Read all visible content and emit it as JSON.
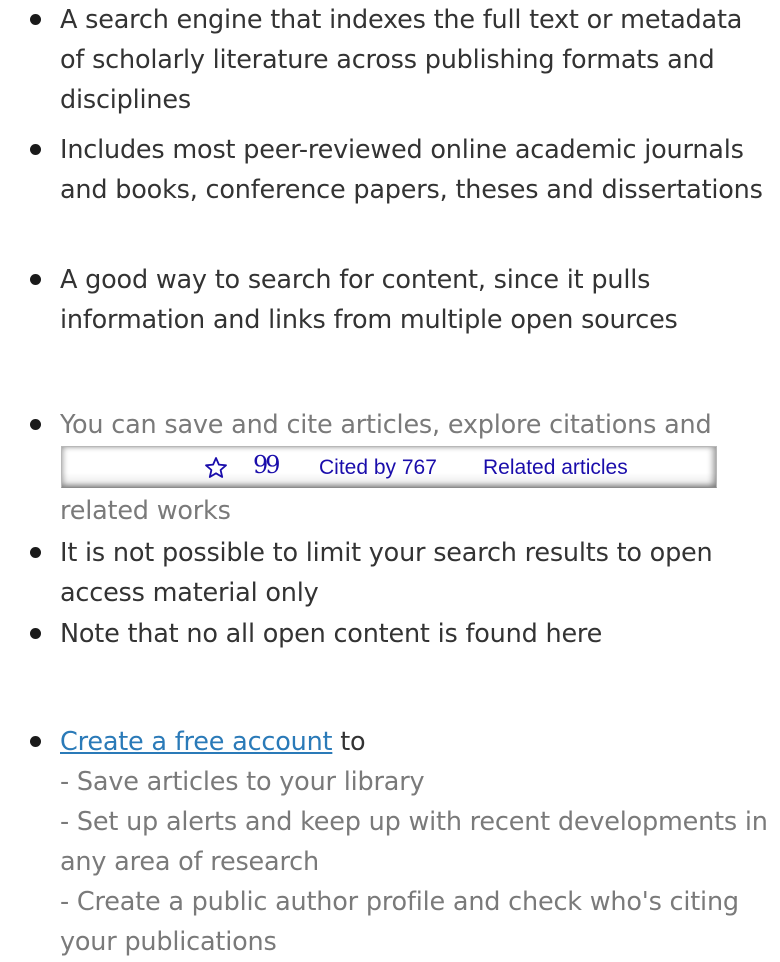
{
  "bullets": [
    {
      "text": "A search engine that indexes the full text or metadata of scholarly literature across publishing formats and disciplines"
    },
    {
      "text": "Includes most peer-reviewed online academic journals and books, conference papers, theses and dissertations"
    },
    {
      "text": "A good way to search for content, since it pulls information and links from multiple open sources"
    },
    {
      "text_before": "You can save and cite articles, explore citations and",
      "text_after": "related works"
    },
    {
      "text": "It is not possible to limit your search results to open access material only"
    },
    {
      "text": "Note that no all open content is found here"
    },
    {
      "link": "Create a free account",
      "link_suffix": " to",
      "subitems": [
        "- Save articles to your library",
        "- Set up alerts and keep up with recent developments in any area of research",
        "- Create a public author profile and check who's citing your publications"
      ]
    }
  ],
  "scholar_bar": {
    "star_icon": "star-icon",
    "quote_icon": "quote-icon",
    "quote_glyph": "99",
    "cited_by": "Cited by 767",
    "related": "Related articles",
    "link_color": "#1a0dab"
  },
  "colors": {
    "text": "#333333",
    "muted": "#7a7a7a",
    "link": "#2a7ab8"
  }
}
